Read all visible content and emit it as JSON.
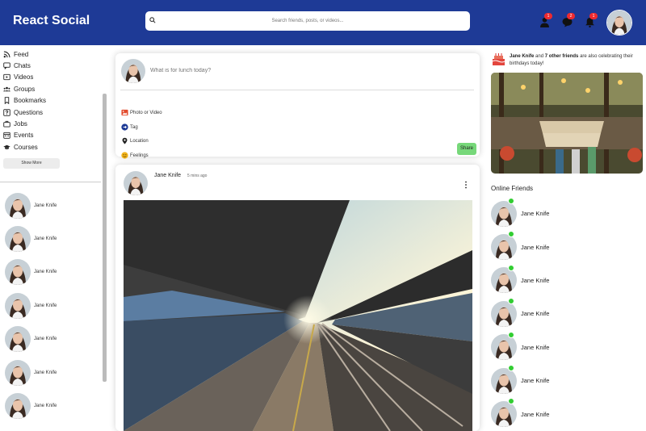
{
  "header": {
    "logo": "React Social",
    "search_placeholder": "Search friends, posts, or videos...",
    "badges": {
      "friends": "1",
      "messages": "2",
      "notifications": "1"
    }
  },
  "sidebar": {
    "items": [
      {
        "label": "Feed",
        "icon": "rss-icon"
      },
      {
        "label": "Chats",
        "icon": "chat-icon"
      },
      {
        "label": "Videos",
        "icon": "video-icon"
      },
      {
        "label": "Groups",
        "icon": "groups-icon"
      },
      {
        "label": "Bookmarks",
        "icon": "bookmark-icon"
      },
      {
        "label": "Questions",
        "icon": "question-icon"
      },
      {
        "label": "Jobs",
        "icon": "briefcase-icon"
      },
      {
        "label": "Events",
        "icon": "calendar-icon"
      },
      {
        "label": "Courses",
        "icon": "graduation-cap-icon"
      }
    ],
    "show_more": "Show More",
    "friends": [
      "Jane Knife",
      "Jane Knife",
      "Jane Knife",
      "Jane Knife",
      "Jane Knife",
      "Jane Knife",
      "Jane Knife"
    ]
  },
  "share": {
    "placeholder": "What is for lunch today?",
    "options": [
      {
        "label": "Photo or Video",
        "icon": "photo-icon",
        "color": "#e24a2c"
      },
      {
        "label": "Tag",
        "icon": "tag-icon",
        "color": "#1e3a96"
      },
      {
        "label": "Location",
        "icon": "location-icon",
        "color": "#222222"
      },
      {
        "label": "Feelings",
        "icon": "smile-icon",
        "color": "#f0b21a"
      }
    ],
    "button": "Share"
  },
  "post": {
    "user": "Jane Knife",
    "time": "5 mins ago"
  },
  "rightbar": {
    "birthday": {
      "name": "Jane Knife",
      "and": "and",
      "others": "7 other friends",
      "rest": "are also celebrating their birthdays today!"
    },
    "online_title": "Online Friends",
    "online": [
      "Jane Knife",
      "Jane Knife",
      "Jane Knife",
      "Jane Knife",
      "Jane Knife",
      "Jane Knife",
      "Jane Knife"
    ]
  },
  "colors": {
    "topbar": "#1e3a96",
    "badge": "#ee2a30",
    "online": "#32cd32",
    "share_button": "#77d87a"
  }
}
